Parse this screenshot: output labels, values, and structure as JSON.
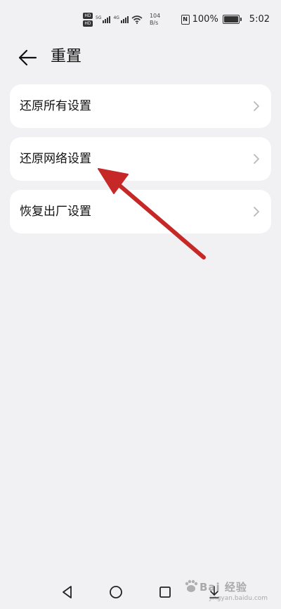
{
  "status_bar": {
    "hd1": "HD",
    "hd2": "HD",
    "signal1_label": "5G",
    "signal2_label": "4G",
    "speed_value": "104",
    "speed_unit": "B/s",
    "nfc": "N",
    "battery": "100%",
    "time": "5:02"
  },
  "header": {
    "title": "重置",
    "back_icon": "arrow-left-icon"
  },
  "items": [
    {
      "label": "还原所有设置",
      "icon": "chevron-right-icon"
    },
    {
      "label": "还原网络设置",
      "icon": "chevron-right-icon"
    },
    {
      "label": "恢复出厂设置",
      "icon": "chevron-right-icon"
    }
  ],
  "nav": {
    "back_icon": "triangle-back-icon",
    "home_icon": "circle-home-icon",
    "recents_icon": "square-recents-icon",
    "extra_icon": "down-arrow-icon"
  },
  "watermark": {
    "text": "Bai 经验",
    "url": "jingyan.baidu.com"
  },
  "colors": {
    "background": "#f1f1f4",
    "card": "#ffffff",
    "annotation": "#c62828"
  }
}
